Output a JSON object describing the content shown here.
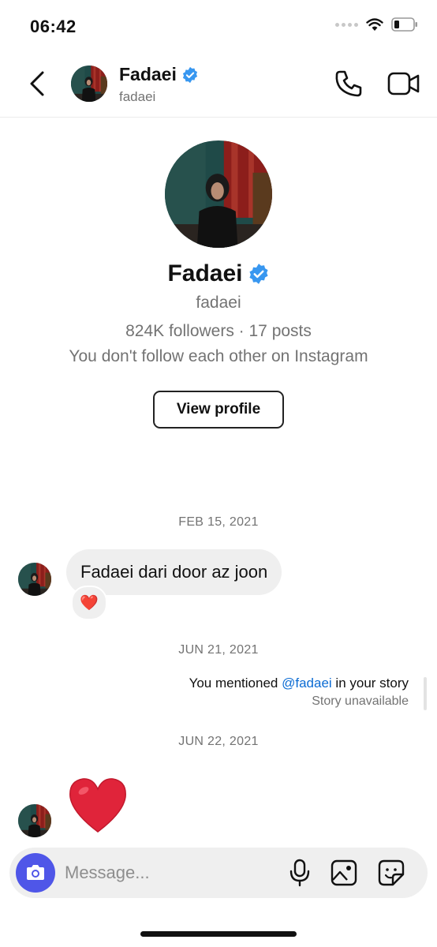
{
  "status_bar": {
    "time": "06:42",
    "signal_icon": "signal-dots-icon",
    "wifi_icon": "wifi-icon",
    "battery_icon": "battery-icon"
  },
  "header": {
    "back_icon": "chevron-left-icon",
    "name": "Fadaei",
    "handle": "fadaei",
    "verified_icon": "verified-badge-icon",
    "call_icon": "phone-icon",
    "video_icon": "video-camera-icon"
  },
  "profile": {
    "name": "Fadaei",
    "handle": "fadaei",
    "stats": "824K followers · 17 posts",
    "follow_note": "You don't follow each other on Instagram",
    "view_profile_label": "View profile"
  },
  "thread": {
    "date_1": "FEB 15, 2021",
    "message_1": "Fadaei dari door az joon",
    "reaction_1": "❤️",
    "date_2": "JUN 21, 2021",
    "mention_prefix": "You mentioned ",
    "mention_user": "@fadaei",
    "mention_suffix": " in your story",
    "story_status": "Story unavailable",
    "date_3": "JUN 22, 2021",
    "message_3_icon": "red-heart-icon"
  },
  "composer": {
    "placeholder": "Message...",
    "camera_icon": "camera-icon",
    "mic_icon": "microphone-icon",
    "gallery_icon": "image-icon",
    "sticker_icon": "sticker-icon"
  },
  "colors": {
    "accent": "#4f56e8",
    "verified": "#3897f0",
    "link": "#0b6bd3",
    "heart": "#e0243a"
  }
}
